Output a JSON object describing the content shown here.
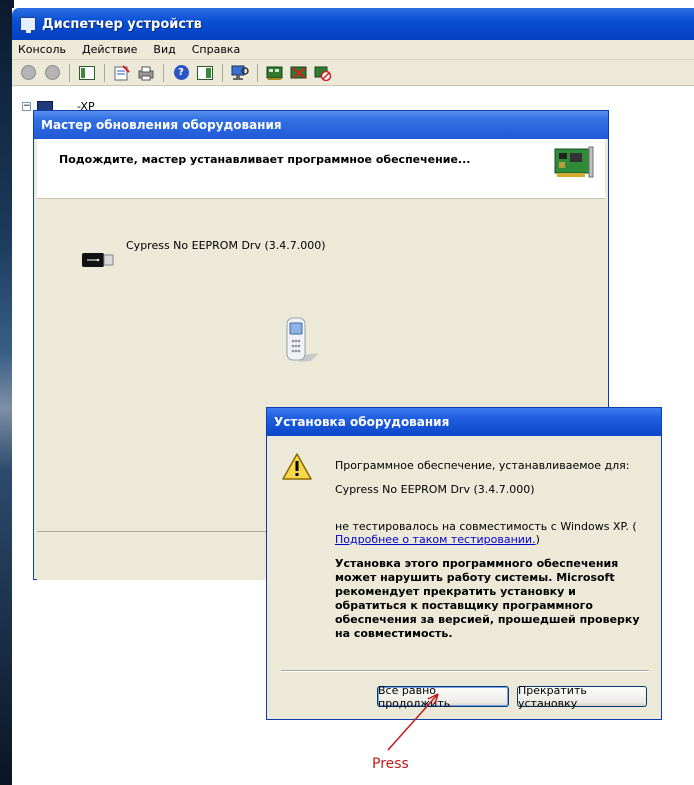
{
  "window": {
    "title": "Диспетчер устройств",
    "menu": [
      "Консоль",
      "Действие",
      "Вид",
      "Справка"
    ],
    "tree_root": "-XP"
  },
  "toolbar_icons": [
    "back-icon",
    "forward-icon",
    "console-tree-icon",
    "properties-icon",
    "print-icon",
    "help-icon",
    "action-pane-icon",
    "scan-hardware-icon",
    "update-driver-icon",
    "disable-device-icon",
    "uninstall-device-icon"
  ],
  "wizard": {
    "title": "Мастер обновления оборудования",
    "header_text": "Подождите, мастер устанавливает программное обеспечение...",
    "driver_name": "Cypress No EEPROM Drv (3.4.7.000)"
  },
  "hardware_dialog": {
    "title": "Установка оборудования",
    "line1": "Программное обеспечение, устанавливаемое для:",
    "device": "Cypress No EEPROM Drv (3.4.7.000)",
    "line2": "не тестировалось на совместимость с Windows XP. (",
    "link": "Подробнее о таком тестировании.",
    "link_tail": ")",
    "warning": "Установка этого программного обеспечения может нарушить работу системы. Microsoft рекомендует прекратить установку и обратиться к поставщику программного обеспечения за версией, прошедшей проверку на совместимость.",
    "continue_label": "Все равно продолжить",
    "stop_label": "Прекратить установку"
  },
  "annotation": {
    "text": "Press",
    "color": "#c01b1b"
  },
  "colors": {
    "title_bar": "#0a4fd4",
    "dialog_face": "#ece9d8",
    "link": "#0000cc"
  }
}
